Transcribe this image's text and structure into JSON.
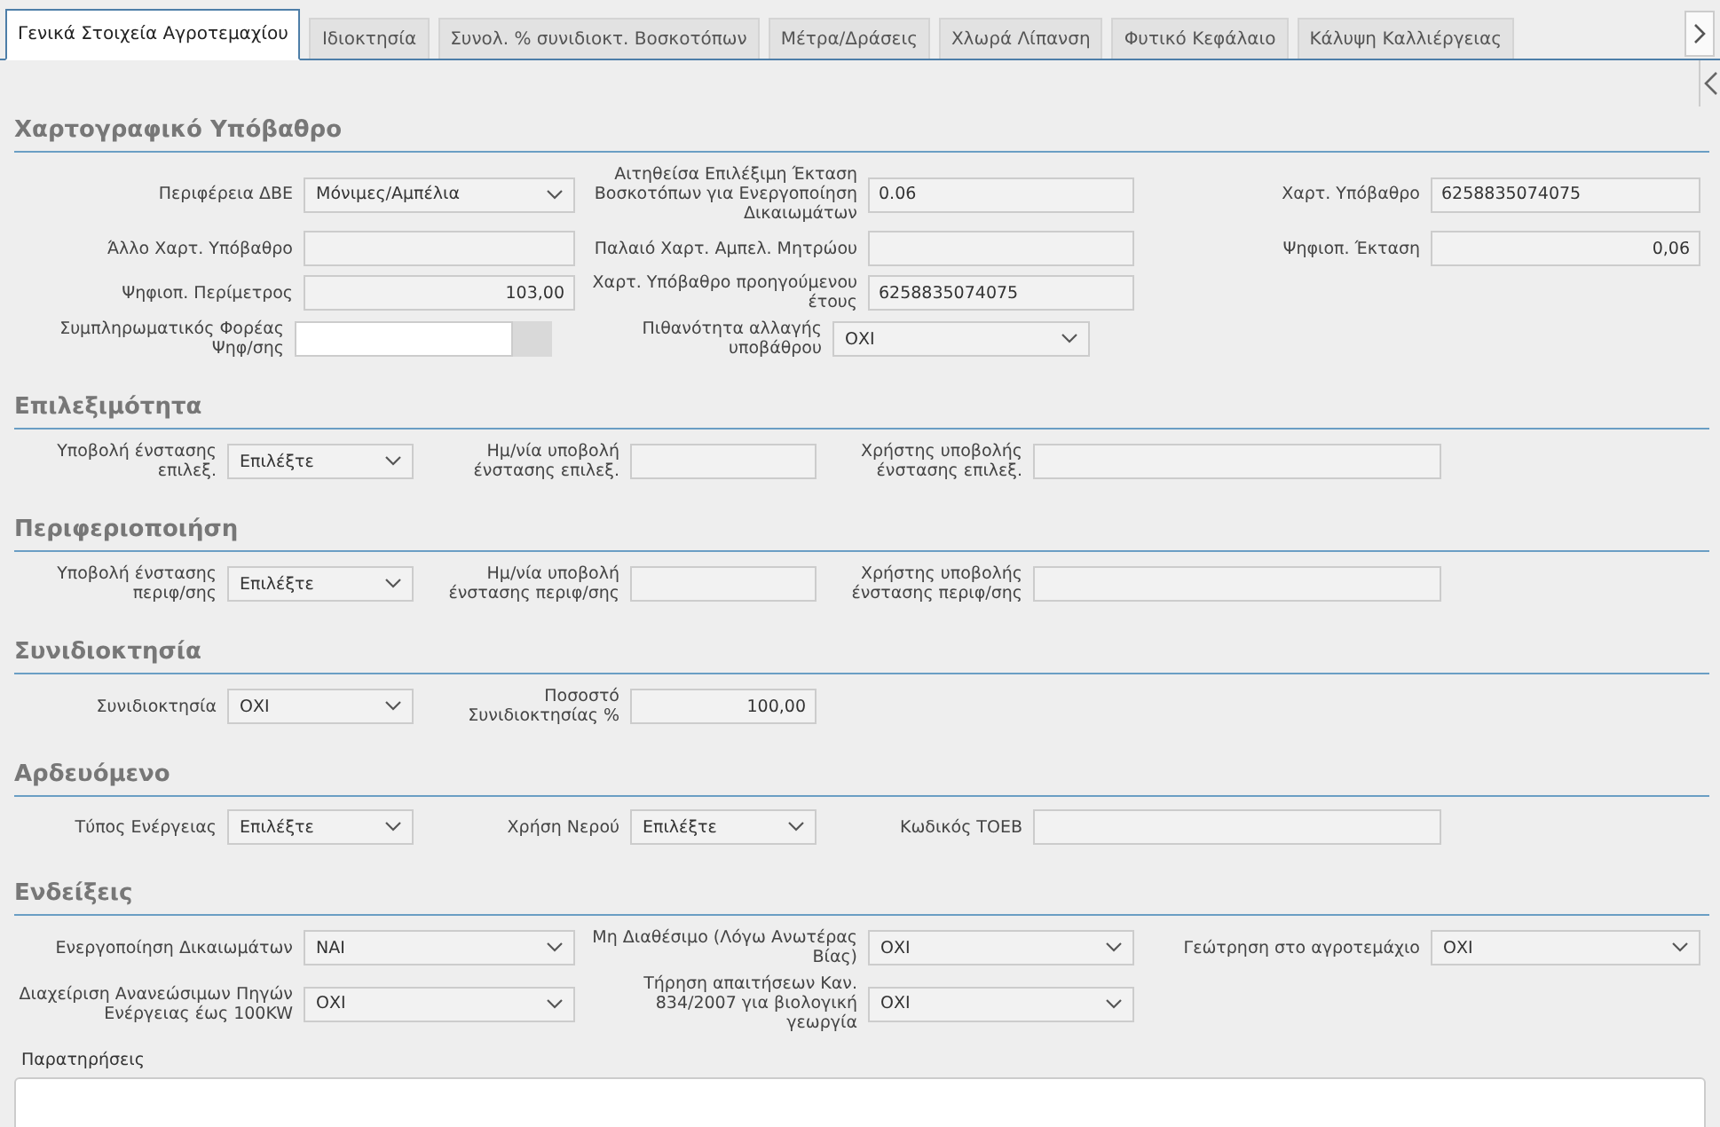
{
  "tabs": [
    {
      "label": "Γενικά Στοιχεία Αγροτεμαχίου",
      "selected": true
    },
    {
      "label": "Ιδιοκτησία",
      "selected": false
    },
    {
      "label": "Συνολ. % συνιδιοκτ. Βοσκοτόπων",
      "selected": false
    },
    {
      "label": "Μέτρα/Δράσεις",
      "selected": false
    },
    {
      "label": "Χλωρά Λίπανση",
      "selected": false
    },
    {
      "label": "Φυτικό Κεφάλαιο",
      "selected": false
    },
    {
      "label": "Κάλυψη Καλλιέργειας",
      "selected": false
    }
  ],
  "sections": [
    {
      "title": "Χαρτογραφικό Υπόβαθρο",
      "rows": [
        {
          "kind": "wide",
          "fields": [
            {
              "label": "Περιφέρεια ΔΒΕ",
              "kind": "select",
              "value": "Μόνιμες/Αμπέλια"
            },
            {
              "label": "Αιτηθείσα Επιλέξιμη Έκταση Βοσκοτόπων για Ενεργοποίηση Δικαιωμάτων",
              "kind": "text",
              "value": "0.06"
            },
            {
              "label": "Χαρτ. Υπόβαθρο",
              "kind": "text",
              "value": "6258835074075"
            }
          ]
        },
        {
          "kind": "wide",
          "fields": [
            {
              "label": "Άλλο Χαρτ. Υπόβαθρο",
              "kind": "text"
            },
            {
              "label": "Παλαιό Χαρτ. Αμπελ. Μητρώου",
              "kind": "text"
            },
            {
              "label": "Ψηφιοπ. Έκταση",
              "kind": "number",
              "value": "0,06"
            }
          ]
        },
        {
          "kind": "wide",
          "fields": [
            {
              "label": "Ψηφιοπ. Περίμετρος",
              "kind": "number",
              "value": "103,00"
            },
            {
              "label": "Χαρτ. Υπόβαθρο προηγούμενου έτους",
              "kind": "text",
              "value": "6258835074075"
            }
          ]
        },
        {
          "kind": "misc",
          "fields": [
            {
              "label": "Συμπληρωματικός Φορέας Ψηφ/σης",
              "kind": "addon"
            },
            {
              "label": "Πιθανότητα αλλαγής υποβάθρου",
              "kind": "select",
              "value": "ΟΧΙ"
            }
          ]
        }
      ]
    },
    {
      "title": "Επιλεξιμότητα",
      "rows": [
        {
          "kind": "narrow",
          "fields": [
            {
              "label": "Υποβολή ένστασης επιλεξ.",
              "kind": "select",
              "value": "Επιλέξτε"
            },
            {
              "label": "Ημ/νία υποβολή ένστασης επιλεξ.",
              "kind": "text"
            },
            {
              "label": "Χρήστης υποβολής ένστασης επιλεξ.",
              "kind": "text"
            }
          ]
        }
      ]
    },
    {
      "title": "Περιφεριοποιήση",
      "rows": [
        {
          "kind": "narrow",
          "fields": [
            {
              "label": "Υποβολή ένστασης περιφ/σης",
              "kind": "select",
              "value": "Επιλέξτε"
            },
            {
              "label": "Ημ/νία υποβολή ένστασης περιφ/σης",
              "kind": "text"
            },
            {
              "label": "Χρήστης υποβολής ένστασης περιφ/σης",
              "kind": "text"
            }
          ]
        }
      ]
    },
    {
      "title": "Συνιδιοκτησία",
      "rows": [
        {
          "kind": "narrow",
          "fields": [
            {
              "label": "Συνιδιοκτησία",
              "kind": "select",
              "value": "ΟΧΙ"
            },
            {
              "label": "Ποσοστό Συνιδιοκτησίας %",
              "kind": "number",
              "value": "100,00"
            }
          ]
        }
      ]
    },
    {
      "title": "Αρδευόμενο",
      "rows": [
        {
          "kind": "narrow",
          "fields": [
            {
              "label": "Τύπος Ενέργειας",
              "kind": "select",
              "value": "Επιλέξτε"
            },
            {
              "label": "Χρήση Νερού",
              "kind": "select",
              "value": "Επιλέξτε"
            },
            {
              "label": "Κωδικός ΤΟΕΒ",
              "kind": "text"
            }
          ]
        }
      ]
    },
    {
      "title": "Ενδείξεις",
      "rows": [
        {
          "kind": "wide",
          "fields": [
            {
              "label": "Ενεργοποίηση Δικαιωμάτων",
              "kind": "select",
              "value": "ΝΑΙ"
            },
            {
              "label": "Μη Διαθέσιμο (Λόγω Ανωτέρας Βίας)",
              "kind": "select",
              "value": "ΟΧΙ"
            },
            {
              "label": "Γεώτρηση στο αγροτεμάχιο",
              "kind": "select",
              "value": "ΟΧΙ"
            }
          ]
        },
        {
          "kind": "wide",
          "fields": [
            {
              "label": "Διαχείριση Ανανεώσιμων Πηγών Ενέργειας έως 100KW",
              "kind": "select",
              "value": "ΟΧΙ"
            },
            {
              "label": "Τήρηση απαιτήσεων Καν. 834/2007 για βιολογική γεωργία",
              "kind": "select",
              "value": "ΟΧΙ"
            }
          ]
        }
      ]
    }
  ],
  "remarks": {
    "label": "Παρατηρήσεις"
  }
}
